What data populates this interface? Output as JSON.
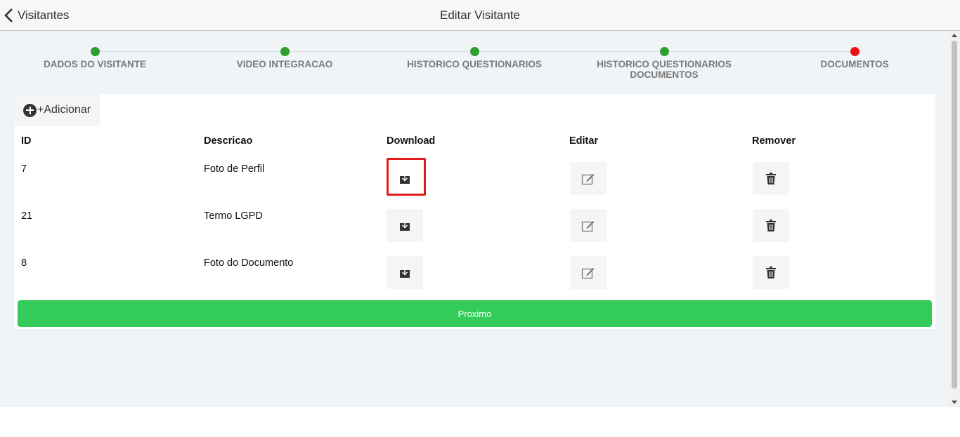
{
  "header": {
    "back_label": "Visitantes",
    "title": "Editar Visitante"
  },
  "stepper": {
    "steps": [
      {
        "label": "DADOS DO VISITANTE",
        "status": "complete",
        "color": "#2e9e2e"
      },
      {
        "label": "VIDEO INTEGRACAO",
        "status": "complete",
        "color": "#2e9e2e"
      },
      {
        "label": "HISTORICO QUESTIONARIOS",
        "status": "complete",
        "color": "#2e9e2e"
      },
      {
        "label": "HISTORICO QUESTIONARIOS DOCUMENTOS",
        "status": "complete",
        "color": "#2e9e2e"
      },
      {
        "label": "DOCUMENTOS",
        "status": "current",
        "color": "#ee1111"
      }
    ]
  },
  "toolbar": {
    "add_label": "+Adicionar",
    "add_icon": "plus-circle-icon"
  },
  "table": {
    "headers": [
      "ID",
      "Descricao",
      "Download",
      "Editar",
      "Remover"
    ],
    "rows": [
      {
        "id": "7",
        "descricao": "Foto de Perfil"
      },
      {
        "id": "21",
        "descricao": "Termo LGPD"
      },
      {
        "id": "8",
        "descricao": "Foto do Documento"
      }
    ],
    "icons": {
      "download": "download-icon",
      "edit": "edit-icon",
      "remove": "trash-icon"
    }
  },
  "next_label": "Proximo",
  "colors": {
    "accent_green": "#33cc5a",
    "step_complete": "#2e9e2e",
    "step_current": "#ee1111",
    "highlight": "#e51a1a"
  }
}
